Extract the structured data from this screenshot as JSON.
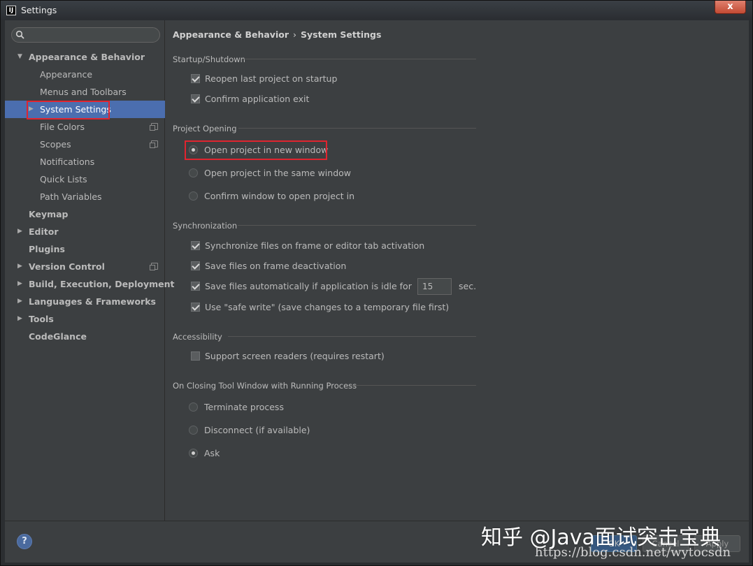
{
  "window": {
    "title": "Settings",
    "close_glyph": "x",
    "app_icon_text": "IJ"
  },
  "search": {
    "placeholder": ""
  },
  "sidebar": {
    "items": [
      {
        "label": "Appearance & Behavior",
        "level": 0,
        "bold": true,
        "expanded": true
      },
      {
        "label": "Appearance",
        "level": 1
      },
      {
        "label": "Menus and Toolbars",
        "level": 1
      },
      {
        "label": "System Settings",
        "level": 1,
        "selected": true,
        "expandable": true
      },
      {
        "label": "File Colors",
        "level": 1,
        "copy_icon": true
      },
      {
        "label": "Scopes",
        "level": 1,
        "copy_icon": true
      },
      {
        "label": "Notifications",
        "level": 1
      },
      {
        "label": "Quick Lists",
        "level": 1
      },
      {
        "label": "Path Variables",
        "level": 1
      },
      {
        "label": "Keymap",
        "level": 0,
        "bold": true
      },
      {
        "label": "Editor",
        "level": 0,
        "bold": true,
        "expandable": true
      },
      {
        "label": "Plugins",
        "level": 0,
        "bold": true
      },
      {
        "label": "Version Control",
        "level": 0,
        "bold": true,
        "expandable": true,
        "copy_icon": true
      },
      {
        "label": "Build, Execution, Deployment",
        "level": 0,
        "bold": true,
        "expandable": true
      },
      {
        "label": "Languages & Frameworks",
        "level": 0,
        "bold": true,
        "expandable": true
      },
      {
        "label": "Tools",
        "level": 0,
        "bold": true,
        "expandable": true
      },
      {
        "label": "CodeGlance",
        "level": 0,
        "bold": true
      }
    ]
  },
  "breadcrumb": {
    "parent": "Appearance & Behavior",
    "separator": "›",
    "current": "System Settings"
  },
  "startup": {
    "title": "Startup/Shutdown",
    "reopen_label": "Reopen last project on startup",
    "reopen_checked": true,
    "confirm_exit_label": "Confirm application exit",
    "confirm_exit_checked": true
  },
  "project_opening": {
    "title": "Project Opening",
    "options": [
      {
        "label": "Open project in new window",
        "checked": true
      },
      {
        "label": "Open project in the same window",
        "checked": false
      },
      {
        "label": "Confirm window to open project in",
        "checked": false
      }
    ]
  },
  "sync": {
    "title": "Synchronization",
    "sync_files_label": "Synchronize files on frame or editor tab activation",
    "save_deactivation_label": "Save files on frame deactivation",
    "save_idle_label": "Save files automatically if application is idle for",
    "idle_value": "15",
    "idle_unit": "sec.",
    "safe_write_label": "Use \"safe write\" (save changes to a temporary file first)"
  },
  "accessibility": {
    "title": "Accessibility",
    "screen_readers_label": "Support screen readers (requires restart)"
  },
  "closing": {
    "title": "On Closing Tool Window with Running Process",
    "options": [
      {
        "label": "Terminate process",
        "checked": false
      },
      {
        "label": "Disconnect (if available)",
        "checked": false
      },
      {
        "label": "Ask",
        "checked": true
      }
    ]
  },
  "footer": {
    "help_label": "?",
    "ok_label": "OK",
    "cancel_label": "Cancel",
    "apply_label": "Apply"
  },
  "watermark": {
    "text": "知乎 @Java面试突击宝典",
    "url": "https://blog.csdn.net/wytocsdn"
  },
  "colors": {
    "selection": "#4b6eaf",
    "highlight_box": "#e0242f",
    "background": "#3c3f41"
  }
}
